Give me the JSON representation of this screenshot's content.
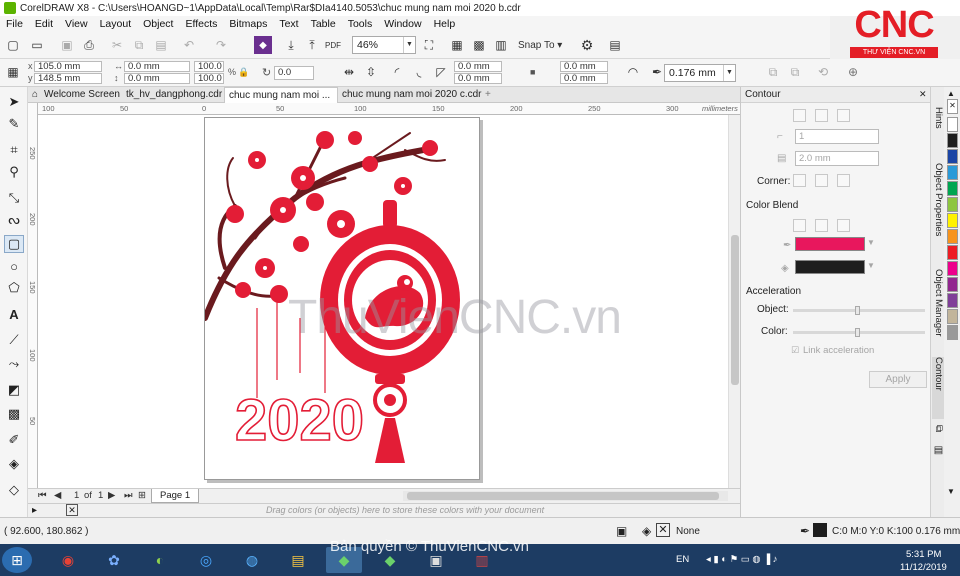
{
  "window": {
    "title": "CorelDRAW X8 - C:\\Users\\HOANGD~1\\AppData\\Local\\Temp\\Rar$DIa4140.5053\\chuc mung nam moi 2020 b.cdr"
  },
  "menu": [
    "File",
    "Edit",
    "View",
    "Layout",
    "Object",
    "Effects",
    "Bitmaps",
    "Text",
    "Table",
    "Tools",
    "Window",
    "Help"
  ],
  "logo": {
    "text": "CNC",
    "subtitle": "THƯ VIỆN CNC.VN"
  },
  "standard_toolbar": {
    "pdf_label": "PDF",
    "zoom": "46%",
    "snap_to": "Snap To"
  },
  "property_bar": {
    "x": "105.0 mm",
    "y": "148.5 mm",
    "w": "0.0 mm",
    "h": "0.0 mm",
    "scale_w": "100.0",
    "scale_h": "100.0",
    "scale_unit": "%",
    "angle": "0.0",
    "corner_a": "0.0 mm",
    "corner_b": "0.0 mm",
    "corner_c": "0.0 mm",
    "corner_d": "0.0 mm",
    "outline_width": "0.176 mm"
  },
  "tabs": [
    {
      "label": "Welcome Screen",
      "active": false
    },
    {
      "label": "tk_hv_dangphong.cdr",
      "active": false
    },
    {
      "label": "chuc mung nam moi ...",
      "active": true
    },
    {
      "label": "chuc mung nam moi 2020 c.cdr",
      "active": false
    }
  ],
  "ruler": {
    "unit": "millimeters",
    "h_ticks": [
      "100",
      "50",
      "0",
      "50",
      "100",
      "150",
      "200",
      "250",
      "300",
      "350"
    ],
    "v_ticks": [
      "250",
      "200",
      "150",
      "100",
      "50"
    ]
  },
  "page_nav": {
    "current": "1",
    "of": "of",
    "total": "1",
    "page_tab": "Page 1"
  },
  "color_well_hint": "Drag colors (or objects) here to store these colors with your document",
  "status": {
    "coords": "( 92.600, 180.862 )",
    "fill": "None",
    "outline": "C:0 M:0 Y:0 K:100  0.176 mm"
  },
  "docker": {
    "title": "Contour",
    "steps": "1",
    "offset": "2.0 mm",
    "corner_label": "Corner:",
    "color_blend_label": "Color Blend",
    "outline_color": "#e8175d",
    "fill_color": "#1e1e1e",
    "acceleration_label": "Acceleration",
    "object_label": "Object:",
    "color_label": "Color:",
    "link_label": "Link acceleration",
    "apply_label": "Apply"
  },
  "side_tabs": [
    "Hints",
    "Object Properties",
    "Object Manager",
    "Contour"
  ],
  "palette": [
    "#ffffff",
    "#1e1e1e",
    "#1b45a5",
    "#2a9ad8",
    "#00a651",
    "#8dc63f",
    "#fff200",
    "#f7941d",
    "#ed1c24",
    "#ec008c",
    "#92278f",
    "#7f3f98",
    "#c2b59b",
    "#999999"
  ],
  "artwork": {
    "year": "2020",
    "primary_color": "#e31d36",
    "branch_color": "#6a1a1e"
  },
  "taskbar": {
    "language": "EN",
    "time": "5:31 PM",
    "date": "11/12/2019"
  },
  "watermark": "ThuVienCNC.vn",
  "watermark_bottom": "Bản quyền © ThuVienCNC.vn"
}
